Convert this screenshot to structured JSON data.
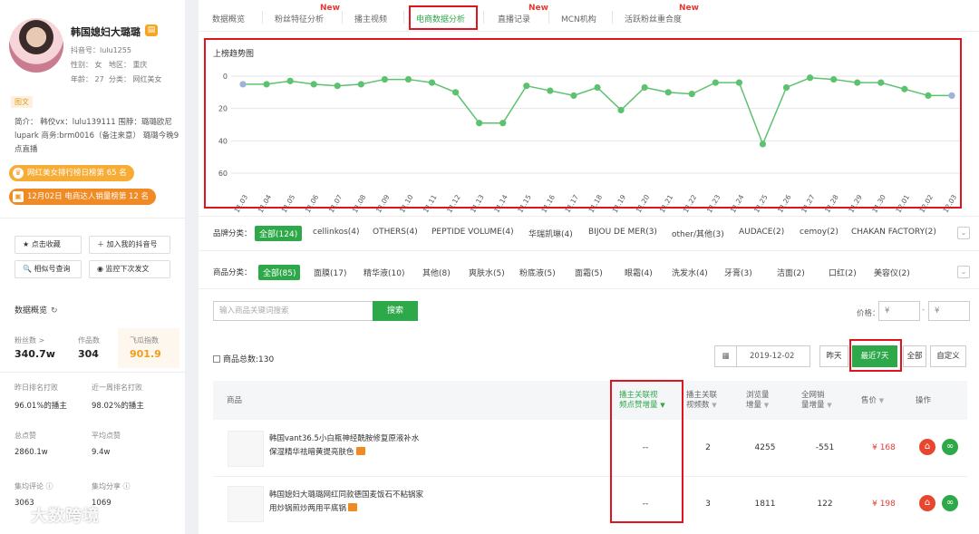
{
  "profile": {
    "name": "韩国媳妇大璐璐",
    "douyin_id": "抖音号：lulu1255",
    "gender": "性别： 女",
    "region": "地区： 重庆",
    "age": "年龄： 27",
    "category": "分类： 网红美女",
    "tag": "图文",
    "intro": "简介： 韩佼vx：lulu139111 围脖：璐璐欧尼lupark 商务:brm0016（备注来意） 璐璐今晚9点直播",
    "rank1": "网红美女排行榜日榜第 65 名",
    "rank2": "12月02日 电商达人销量榜第 12 名"
  },
  "actions": {
    "collect": "★ 点击收藏",
    "add_board": "＋ 加入我的抖音号",
    "similar": "🔍 相似号查询",
    "monitor": "◉ 监控下次发文"
  },
  "overview": {
    "title": "数据概览",
    "refresh_icon": "refresh-icon",
    "fans_label": "粉丝数 >",
    "fans_value": "340.7w",
    "works_label": "作品数",
    "works_value": "304",
    "index_label": "飞瓜指数",
    "index_value": "901.9",
    "yday_label": "昨日排名打败",
    "yday_value": "96.01%的播主",
    "week_label": "近一周排名打败",
    "week_value": "98.02%的播主",
    "likes_label": "总点赞",
    "likes_value": "2860.1w",
    "avg_likes_label": "平均点赞",
    "avg_likes_value": "9.4w",
    "avg_comment_label": "集均评论 ⓘ",
    "avg_comment_value": "3063",
    "avg_share_label": "集均分享 ⓘ",
    "avg_share_value": "1069"
  },
  "watermark": "大数跨境",
  "tabs": [
    {
      "label": "数据概览"
    },
    {
      "label": "粉丝特征分析",
      "badge": "New"
    },
    {
      "label": "播主视频"
    },
    {
      "label": "电商数据分析",
      "active": true
    },
    {
      "label": "直播记录",
      "badge": "New"
    },
    {
      "label": "MCN机构"
    },
    {
      "label": "活跃粉丝重合度",
      "badge": "New"
    }
  ],
  "chart_data": {
    "type": "line",
    "title": "上榜趋势图",
    "x": [
      "11.03",
      "11.04",
      "11.05",
      "11.06",
      "11.07",
      "11.08",
      "11.09",
      "11.10",
      "11.11",
      "11.12",
      "11.13",
      "11.14",
      "11.15",
      "11.16",
      "11.17",
      "11.18",
      "11.19",
      "11.20",
      "11.21",
      "11.22",
      "11.23",
      "11.24",
      "11.25",
      "11.26",
      "11.27",
      "11.28",
      "11.29",
      "11.30",
      "12.01",
      "12.02",
      "12.03"
    ],
    "values": [
      5,
      5,
      3,
      5,
      6,
      5,
      2,
      2,
      4,
      10,
      29,
      29,
      6,
      9,
      12,
      7,
      21,
      7,
      10,
      11,
      4,
      4,
      42,
      7,
      1,
      2,
      4,
      4,
      8,
      12,
      12
    ],
    "yticks": [
      0,
      20,
      40,
      60
    ],
    "ylim": [
      0,
      60
    ],
    "y_inverted": true,
    "grid": "horizontal",
    "line_color": "#5cc26f",
    "marker_color": "#5cc26f",
    "endpoint_color": "#9fb2d9"
  },
  "brand_filter": {
    "label": "品牌分类：",
    "items": [
      "全部(124)",
      "cellinkos(4)",
      "OTHERS(4)",
      "PEPTIDE VOLUME(4)",
      "华瑞凯琳(4)",
      "BIJOU DE MER(3)",
      "other/其他(3)",
      "AUDACE(2)",
      "cemoy(2)",
      "CHAKAN FACTORY(2)"
    ]
  },
  "category_filter": {
    "label": "商品分类：",
    "items": [
      "全部(85)",
      "面膜(17)",
      "精华液(10)",
      "其他(8)",
      "爽肤水(5)",
      "粉底液(5)",
      "面霜(5)",
      "眼霜(4)",
      "洗发水(4)",
      "牙膏(3)",
      "洁面(2)",
      "口红(2)",
      "美容仪(2)"
    ]
  },
  "search": {
    "placeholder": "输入商品关键词搜索",
    "button": "搜索",
    "price_label": "价格：",
    "price_min": "¥",
    "price_max": "¥",
    "dash": "-"
  },
  "summary": {
    "count": "商品总数:130",
    "date": "2019-12-02",
    "yesterday": "昨天",
    "last7": "最近7天",
    "all": "全部",
    "custom": "自定义"
  },
  "table": {
    "headers": {
      "product": "商品",
      "video_increase_1": "播主关联视",
      "video_increase_2": "频点赞增量",
      "video_count_1": "播主关联",
      "video_count_2": "视频数",
      "views_1": "浏览量",
      "views_2": "增量",
      "sales_1": "全网销",
      "sales_2": "量增量",
      "price": "售价",
      "ops": "操作"
    },
    "rows": [
      {
        "name": "韩国vant36.5小白瓶神经酰胺修复原液补水保湿精华祛暗黄提亮肤色",
        "likes_increase": "--",
        "video_count": "2",
        "views": "4255",
        "sales": "-551",
        "price": "¥ 168"
      },
      {
        "name": "韩国媳妇大璐璐网红同款德国麦饭石不粘锅家用炒锅煎炒两用平底锅",
        "likes_increase": "--",
        "video_count": "3",
        "views": "1811",
        "sales": "122",
        "price": "¥ 198"
      }
    ]
  }
}
